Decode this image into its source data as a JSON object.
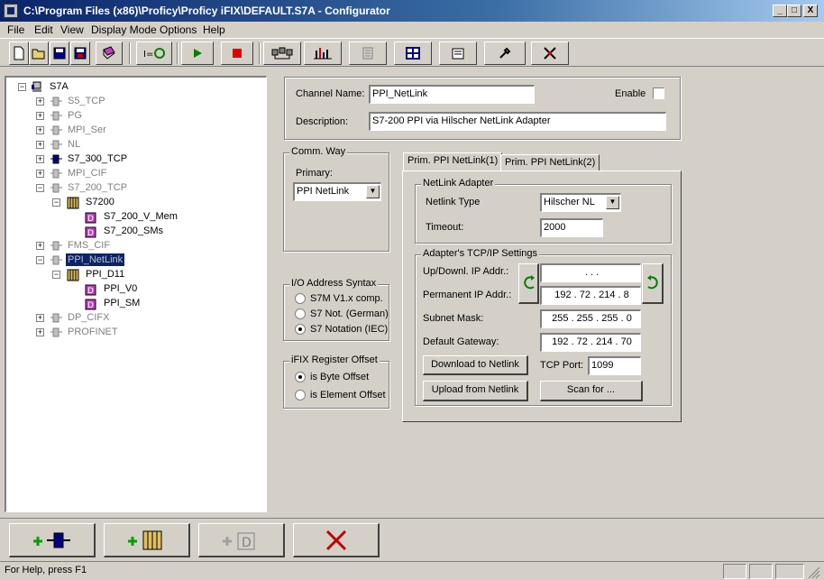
{
  "window": {
    "title": "C:\\Program Files (x86)\\Proficy\\Proficy iFIX\\DEFAULT.S7A - Configurator",
    "minimize": "_",
    "maximize": "□",
    "close": "X"
  },
  "menu": [
    "File",
    "Edit",
    "View",
    "Display Mode",
    "Options",
    "Help"
  ],
  "toolbar": {
    "icons": [
      "new-icon",
      "open-icon",
      "save-icon",
      "save-as-icon",
      "book-icon",
      "io-refresh-icon",
      "run-icon",
      "stop-icon",
      "network-icon",
      "statistics-icon",
      "register-icon",
      "channel-icon",
      "properties-icon",
      "wrench-icon",
      "tools-icon"
    ]
  },
  "tree": {
    "root": "S7A",
    "channels": [
      {
        "label": "S5_TCP"
      },
      {
        "label": "PG"
      },
      {
        "label": "MPI_Ser"
      },
      {
        "label": "NL"
      },
      {
        "label": "S7_300_TCP"
      },
      {
        "label": "MPI_CIF"
      },
      {
        "label": "S7_200_TCP"
      },
      {
        "label": "S7200"
      },
      {
        "label": "S7_200_V_Mem"
      },
      {
        "label": "S7_200_SMs"
      },
      {
        "label": "FMS_CIF"
      },
      {
        "label": "PPI_NetLink"
      },
      {
        "label": "PPI_D11"
      },
      {
        "label": "PPI_V0"
      },
      {
        "label": "PPI_SM"
      },
      {
        "label": "DP_CIFX"
      },
      {
        "label": "PROFINET"
      }
    ]
  },
  "channel": {
    "name_label": "Channel Name:",
    "name_value": "PPI_NetLink",
    "enable_label": "Enable",
    "desc_label": "Description:",
    "desc_value": "S7-200 PPI via Hilscher NetLink Adapter"
  },
  "comm_way": {
    "group": "Comm. Way",
    "primary_label": "Primary:",
    "primary_value": "PPI NetLink"
  },
  "io_syntax": {
    "group": "I/O Address Syntax",
    "options": [
      "S7M V1.x comp.",
      "S7 Not. (German)",
      "S7 Notation (IEC)"
    ],
    "selected": 2
  },
  "register_offset": {
    "group": "iFIX Register Offset",
    "options": [
      "is Byte Offset",
      "is Element Offset"
    ],
    "selected": 0
  },
  "tabs": [
    "Prim. PPI NetLink(1)",
    "Prim. PPI NetLink(2)"
  ],
  "netlink": {
    "group": "NetLink Adapter",
    "type_label": "Netlink Type",
    "type_value": "Hilscher NL",
    "timeout_label": "Timeout:",
    "timeout_value": "2000"
  },
  "tcpip": {
    "group": "Adapter's TCP/IP Settings",
    "updown_label": "Up/Downl. IP Addr.:",
    "updown_value": " .    .    . ",
    "perm_label": "Permanent IP Addr.:",
    "perm_value": "192 . 72 . 214 . 8",
    "subnet_label": "Subnet Mask:",
    "subnet_value": "255 . 255 . 255 . 0",
    "gateway_label": "Default Gateway:",
    "gateway_value": "192 . 72 . 214 . 70",
    "download_btn": "Download to Netlink",
    "tcpport_label": "TCP Port:",
    "tcpport_value": "1099",
    "upload_btn": "Upload from Netlink",
    "scan_btn": "Scan for ..."
  },
  "status": {
    "text": "For Help, press F1"
  }
}
